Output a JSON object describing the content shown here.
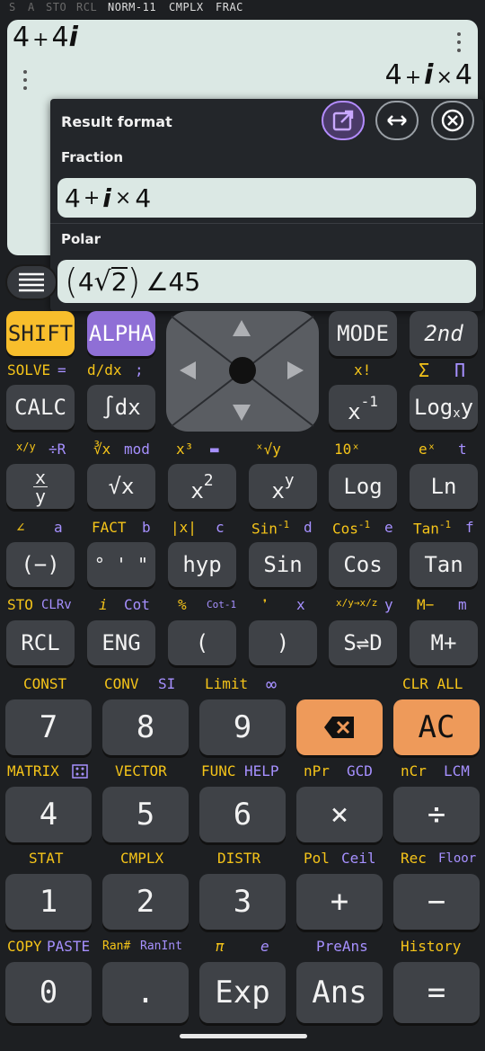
{
  "status": {
    "items": [
      "S",
      "A",
      "STO",
      "RCL",
      "NORM-11",
      "CMPLX",
      "FRAC"
    ]
  },
  "display": {
    "expr_a": "4",
    "expr_op": "+",
    "expr_b": "4",
    "expr_i": "i",
    "res_a": "4",
    "res_op": "+",
    "res_i": "i",
    "res_x": "×",
    "res_b": "4"
  },
  "popup": {
    "title": "Result format",
    "fraction_label": "Fraction",
    "fraction_value": {
      "a": "4",
      "plus": "+",
      "i": "i",
      "x": "×",
      "b": "4"
    },
    "polar_label": "Polar",
    "polar_value": {
      "coef": "4",
      "rad": "2",
      "angle": "∠45"
    },
    "icons": [
      "open-external-icon",
      "swap-horizontal-icon",
      "close-circle-icon"
    ]
  },
  "keys": {
    "row1": {
      "shift": "SHIFT",
      "alpha": "ALPHA",
      "mode": "MODE",
      "second": "2nd"
    },
    "row1_sub": {
      "solve": "SOLVE",
      "eq": "=",
      "ddx": "d/dx",
      "semi": ";",
      "xfact": "x!",
      "sigma": "Σ",
      "pi": "Π"
    },
    "row2": {
      "calc": "CALC",
      "intdx": "∫dx",
      "xinv": "x",
      "xinv_sup": "-1",
      "logxy": "Log",
      "logxy_sub": "x",
      "logxy_y": "y"
    },
    "row2_sub": {
      "xy": "x/y",
      "r": "÷R",
      "cuberoot": "∛x",
      "mod": "mod",
      "x3": "x³",
      "bar": "▬",
      "xroot": "ˣ√y",
      "tenx": "10ˣ",
      "ex": "eˣ",
      "t": "t"
    },
    "row3": {
      "frac": "x/y",
      "sqrt": "√x",
      "x2": "x",
      "x2_sup": "2",
      "xy": "x",
      "xy_sup": "y",
      "log": "Log",
      "ln": "Ln"
    },
    "row3_sub": {
      "angle": "∠",
      "a": "a",
      "fact": "FACT",
      "b": "b",
      "abs": "|x|",
      "c": "c",
      "sin_inv": "Sin",
      "d": "d",
      "cos_inv": "Cos",
      "e": "e",
      "tan_inv": "Tan",
      "f": "f",
      "inv_sup": "-1"
    },
    "row4": {
      "neg": "(−)",
      "dms": "° ' \"",
      "hyp": "hyp",
      "sin": "Sin",
      "cos": "Cos",
      "tan": "Tan"
    },
    "row4_sub": {
      "sto": "STO",
      "clrv": "CLRv",
      "i": "i",
      "cot": "Cot",
      "pct": "%",
      "cot_inv": "Cot-1",
      "comma": "❜",
      "x": "x",
      "conv": "x/y→x/z",
      "y": "y",
      "mminus": "M−",
      "m": "m"
    },
    "row5": {
      "rcl": "RCL",
      "eng": "ENG",
      "lparen": "(",
      "rparen": ")",
      "sd": "S⇌D",
      "mplus": "M+"
    },
    "row5_sub": {
      "const": "CONST",
      "conv": "CONV",
      "si": "SI",
      "limit": "Limit",
      "inf": "∞",
      "clr_all": "CLR ALL"
    },
    "row6": {
      "seven": "7",
      "eight": "8",
      "nine": "9",
      "ac": "AC"
    },
    "row6_sub": {
      "matrix": "MATRIX",
      "vector": "VECTOR",
      "func": "FUNC",
      "help": "HELP",
      "npr": "nPr",
      "gcd": "GCD",
      "ncr": "nCr",
      "lcm": "LCM"
    },
    "row7": {
      "four": "4",
      "five": "5",
      "six": "6",
      "times": "×",
      "div": "÷"
    },
    "row7_sub": {
      "stat": "STAT",
      "cmplx": "CMPLX",
      "distr": "DISTR",
      "pol": "Pol",
      "ceil": "Ceil",
      "rec": "Rec",
      "floor": "Floor"
    },
    "row8": {
      "one": "1",
      "two": "2",
      "three": "3",
      "plus": "+",
      "minus": "−"
    },
    "row8_sub": {
      "copy": "COPY",
      "paste": "PASTE",
      "ran": "Ran#",
      "ranint": "RanInt",
      "pi": "π",
      "e": "e",
      "preans": "PreAns",
      "history": "History"
    },
    "row9": {
      "zero": "0",
      "dot": ".",
      "exp": "Exp",
      "ans": "Ans",
      "eq": "="
    }
  }
}
